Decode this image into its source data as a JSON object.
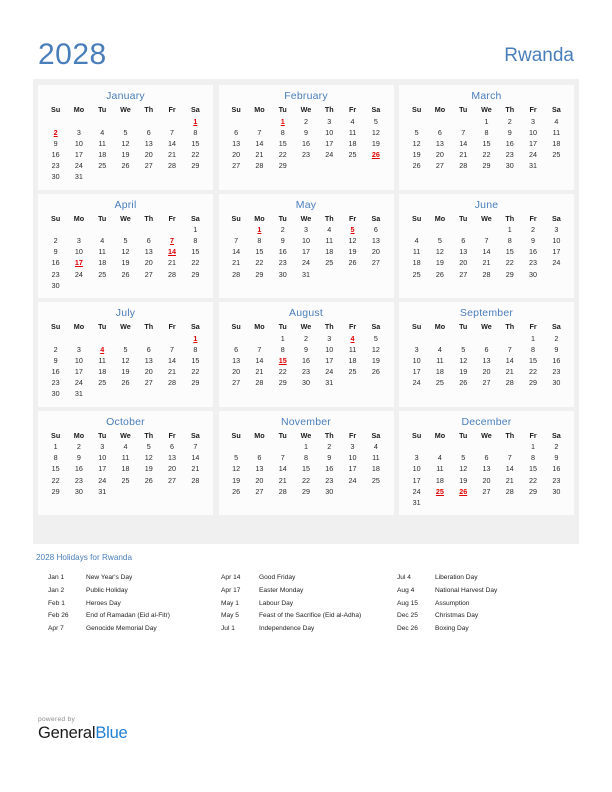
{
  "header": {
    "year": "2028",
    "country": "Rwanda",
    "accent_color": "#4a7ebb"
  },
  "weekday_headers": [
    "Su",
    "Mo",
    "Tu",
    "We",
    "Th",
    "Fr",
    "Sa"
  ],
  "holiday_color": "#dd0000",
  "months": [
    {
      "name": "January",
      "weeks": [
        [
          "",
          "",
          "",
          "",
          "",
          "",
          "1"
        ],
        [
          "2",
          "3",
          "4",
          "5",
          "6",
          "7",
          "8"
        ],
        [
          "9",
          "10",
          "11",
          "12",
          "13",
          "14",
          "15"
        ],
        [
          "16",
          "17",
          "18",
          "19",
          "20",
          "21",
          "22"
        ],
        [
          "23",
          "24",
          "25",
          "26",
          "27",
          "28",
          "29"
        ],
        [
          "30",
          "31",
          "",
          "",
          "",
          "",
          ""
        ]
      ],
      "holidays": [
        "1",
        "2"
      ]
    },
    {
      "name": "February",
      "weeks": [
        [
          "",
          "",
          "1",
          "2",
          "3",
          "4",
          "5"
        ],
        [
          "6",
          "7",
          "8",
          "9",
          "10",
          "11",
          "12"
        ],
        [
          "13",
          "14",
          "15",
          "16",
          "17",
          "18",
          "19"
        ],
        [
          "20",
          "21",
          "22",
          "23",
          "24",
          "25",
          "26"
        ],
        [
          "27",
          "28",
          "29",
          "",
          "",
          "",
          ""
        ],
        [
          "",
          "",
          "",
          "",
          "",
          "",
          ""
        ]
      ],
      "holidays": [
        "1",
        "26"
      ]
    },
    {
      "name": "March",
      "weeks": [
        [
          "",
          "",
          "",
          "1",
          "2",
          "3",
          "4"
        ],
        [
          "5",
          "6",
          "7",
          "8",
          "9",
          "10",
          "11"
        ],
        [
          "12",
          "13",
          "14",
          "15",
          "16",
          "17",
          "18"
        ],
        [
          "19",
          "20",
          "21",
          "22",
          "23",
          "24",
          "25"
        ],
        [
          "26",
          "27",
          "28",
          "29",
          "30",
          "31",
          ""
        ],
        [
          "",
          "",
          "",
          "",
          "",
          "",
          ""
        ]
      ],
      "holidays": []
    },
    {
      "name": "April",
      "weeks": [
        [
          "",
          "",
          "",
          "",
          "",
          "",
          "1"
        ],
        [
          "2",
          "3",
          "4",
          "5",
          "6",
          "7",
          "8"
        ],
        [
          "9",
          "10",
          "11",
          "12",
          "13",
          "14",
          "15"
        ],
        [
          "16",
          "17",
          "18",
          "19",
          "20",
          "21",
          "22"
        ],
        [
          "23",
          "24",
          "25",
          "26",
          "27",
          "28",
          "29"
        ],
        [
          "30",
          "",
          "",
          "",
          "",
          "",
          ""
        ]
      ],
      "holidays": [
        "7",
        "14",
        "17"
      ]
    },
    {
      "name": "May",
      "weeks": [
        [
          "",
          "1",
          "2",
          "3",
          "4",
          "5",
          "6"
        ],
        [
          "7",
          "8",
          "9",
          "10",
          "11",
          "12",
          "13"
        ],
        [
          "14",
          "15",
          "16",
          "17",
          "18",
          "19",
          "20"
        ],
        [
          "21",
          "22",
          "23",
          "24",
          "25",
          "26",
          "27"
        ],
        [
          "28",
          "29",
          "30",
          "31",
          "",
          "",
          ""
        ],
        [
          "",
          "",
          "",
          "",
          "",
          "",
          ""
        ]
      ],
      "holidays": [
        "1",
        "5"
      ]
    },
    {
      "name": "June",
      "weeks": [
        [
          "",
          "",
          "",
          "",
          "1",
          "2",
          "3"
        ],
        [
          "4",
          "5",
          "6",
          "7",
          "8",
          "9",
          "10"
        ],
        [
          "11",
          "12",
          "13",
          "14",
          "15",
          "16",
          "17"
        ],
        [
          "18",
          "19",
          "20",
          "21",
          "22",
          "23",
          "24"
        ],
        [
          "25",
          "26",
          "27",
          "28",
          "29",
          "30",
          ""
        ],
        [
          "",
          "",
          "",
          "",
          "",
          "",
          ""
        ]
      ],
      "holidays": []
    },
    {
      "name": "July",
      "weeks": [
        [
          "",
          "",
          "",
          "",
          "",
          "",
          "1"
        ],
        [
          "2",
          "3",
          "4",
          "5",
          "6",
          "7",
          "8"
        ],
        [
          "9",
          "10",
          "11",
          "12",
          "13",
          "14",
          "15"
        ],
        [
          "16",
          "17",
          "18",
          "19",
          "20",
          "21",
          "22"
        ],
        [
          "23",
          "24",
          "25",
          "26",
          "27",
          "28",
          "29"
        ],
        [
          "30",
          "31",
          "",
          "",
          "",
          "",
          ""
        ]
      ],
      "holidays": [
        "1",
        "4"
      ]
    },
    {
      "name": "August",
      "weeks": [
        [
          "",
          "",
          "1",
          "2",
          "3",
          "4",
          "5"
        ],
        [
          "6",
          "7",
          "8",
          "9",
          "10",
          "11",
          "12"
        ],
        [
          "13",
          "14",
          "15",
          "16",
          "17",
          "18",
          "19"
        ],
        [
          "20",
          "21",
          "22",
          "23",
          "24",
          "25",
          "26"
        ],
        [
          "27",
          "28",
          "29",
          "30",
          "31",
          "",
          ""
        ],
        [
          "",
          "",
          "",
          "",
          "",
          "",
          ""
        ]
      ],
      "holidays": [
        "4",
        "15"
      ]
    },
    {
      "name": "September",
      "weeks": [
        [
          "",
          "",
          "",
          "",
          "",
          "1",
          "2"
        ],
        [
          "3",
          "4",
          "5",
          "6",
          "7",
          "8",
          "9"
        ],
        [
          "10",
          "11",
          "12",
          "13",
          "14",
          "15",
          "16"
        ],
        [
          "17",
          "18",
          "19",
          "20",
          "21",
          "22",
          "23"
        ],
        [
          "24",
          "25",
          "26",
          "27",
          "28",
          "29",
          "30"
        ],
        [
          "",
          "",
          "",
          "",
          "",
          "",
          ""
        ]
      ],
      "holidays": []
    },
    {
      "name": "October",
      "weeks": [
        [
          "1",
          "2",
          "3",
          "4",
          "5",
          "6",
          "7"
        ],
        [
          "8",
          "9",
          "10",
          "11",
          "12",
          "13",
          "14"
        ],
        [
          "15",
          "16",
          "17",
          "18",
          "19",
          "20",
          "21"
        ],
        [
          "22",
          "23",
          "24",
          "25",
          "26",
          "27",
          "28"
        ],
        [
          "29",
          "30",
          "31",
          "",
          "",
          "",
          ""
        ],
        [
          "",
          "",
          "",
          "",
          "",
          "",
          ""
        ]
      ],
      "holidays": []
    },
    {
      "name": "November",
      "weeks": [
        [
          "",
          "",
          "",
          "1",
          "2",
          "3",
          "4"
        ],
        [
          "5",
          "6",
          "7",
          "8",
          "9",
          "10",
          "11"
        ],
        [
          "12",
          "13",
          "14",
          "15",
          "16",
          "17",
          "18"
        ],
        [
          "19",
          "20",
          "21",
          "22",
          "23",
          "24",
          "25"
        ],
        [
          "26",
          "27",
          "28",
          "29",
          "30",
          "",
          ""
        ],
        [
          "",
          "",
          "",
          "",
          "",
          "",
          ""
        ]
      ],
      "holidays": []
    },
    {
      "name": "December",
      "weeks": [
        [
          "",
          "",
          "",
          "",
          "",
          "1",
          "2"
        ],
        [
          "3",
          "4",
          "5",
          "6",
          "7",
          "8",
          "9"
        ],
        [
          "10",
          "11",
          "12",
          "13",
          "14",
          "15",
          "16"
        ],
        [
          "17",
          "18",
          "19",
          "20",
          "21",
          "22",
          "23"
        ],
        [
          "24",
          "25",
          "26",
          "27",
          "28",
          "29",
          "30"
        ],
        [
          "31",
          "",
          "",
          "",
          "",
          "",
          ""
        ]
      ],
      "holidays": [
        "25",
        "26"
      ]
    }
  ],
  "holidays_section": {
    "title": "2028 Holidays for Rwanda",
    "columns": [
      [
        {
          "date": "Jan 1",
          "name": "New Year's Day"
        },
        {
          "date": "Jan 2",
          "name": "Public Holiday"
        },
        {
          "date": "Feb 1",
          "name": "Heroes Day"
        },
        {
          "date": "Feb 26",
          "name": "End of Ramadan (Eid al-Fitr)"
        },
        {
          "date": "Apr 7",
          "name": "Genocide Memorial Day"
        }
      ],
      [
        {
          "date": "Apr 14",
          "name": "Good Friday"
        },
        {
          "date": "Apr 17",
          "name": "Easter Monday"
        },
        {
          "date": "May 1",
          "name": "Labour Day"
        },
        {
          "date": "May 5",
          "name": "Feast of the Sacrifice (Eid al-Adha)"
        },
        {
          "date": "Jul 1",
          "name": "Independence Day"
        }
      ],
      [
        {
          "date": "Jul 4",
          "name": "Liberation Day"
        },
        {
          "date": "Aug 4",
          "name": "National Harvest Day"
        },
        {
          "date": "Aug 15",
          "name": "Assumption"
        },
        {
          "date": "Dec 25",
          "name": "Christmas Day"
        },
        {
          "date": "Dec 26",
          "name": "Boxing Day"
        }
      ]
    ]
  },
  "footer": {
    "powered_by": "powered by",
    "brand_first": "General",
    "brand_second": "Blue",
    "brand_color": "#1f7fd4"
  }
}
